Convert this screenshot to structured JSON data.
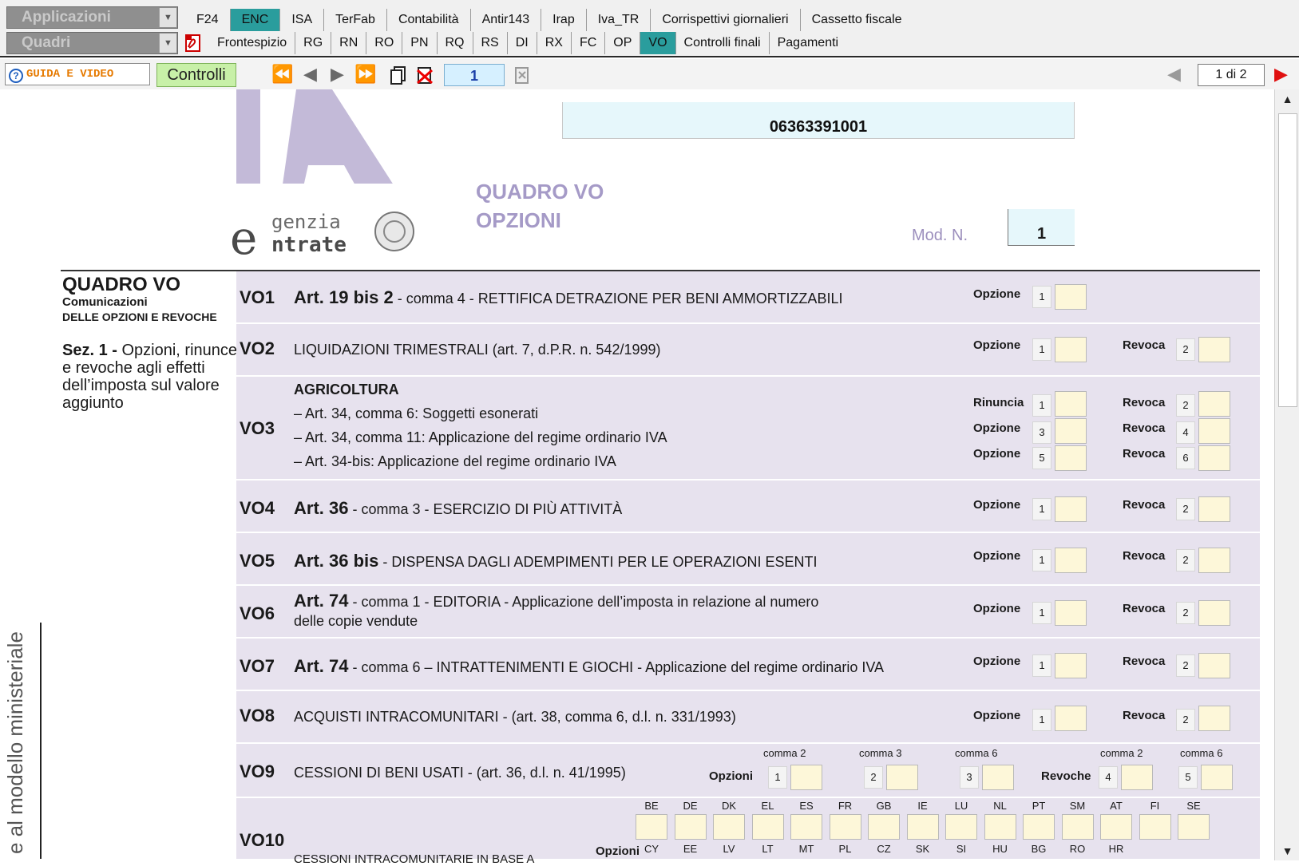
{
  "toolbar": {
    "app_combo": "Applicazioni",
    "quadri_combo": "Quadri",
    "tabs_row1": [
      "F24",
      "ENC",
      "ISA",
      "TerFab",
      "Contabilità",
      "Antir143",
      "Irap",
      "Iva_TR",
      "Corrispettivi giornalieri",
      "Cassetto fiscale"
    ],
    "tabs_row2": [
      "Frontespizio",
      "RG",
      "RN",
      "RO",
      "PN",
      "RQ",
      "RS",
      "DI",
      "RX",
      "FC",
      "OP",
      "VO",
      "Controlli finali",
      "Pagamenti"
    ],
    "selected_row1": "ENC",
    "selected_row2": "VO",
    "guida": "GUIDA E VIDEO",
    "controlli": "Controlli",
    "page_input": "1",
    "page_of": "1 di 2"
  },
  "header": {
    "codice_fiscale": "06363391001",
    "quadro_title_1": "QUADRO VO",
    "quadro_title_2": "OPZIONI",
    "mod_n_label": "Mod. N.",
    "mod_n_value": "1",
    "logo_text_1": "genzia",
    "logo_text_2": "ntrate"
  },
  "left": {
    "title": "QUADRO VO",
    "sub1": "Comunicazioni",
    "sub2": "delle opzioni e revoche",
    "sez": "Sez. 1 -",
    "sez_text": " Opzioni, rinunce e revoche agli effetti dell’imposta sul valore aggiunto",
    "side": "e al modello ministeriale"
  },
  "rows": {
    "vo1": {
      "code": "VO1",
      "art": "Art. 19 bis 2",
      "text": " - comma 4 - RETTIFICA DETRAZIONE PER BENI AMMORTIZZABILI",
      "opt_label": "Opzione",
      "opt_num": "1"
    },
    "vo2": {
      "code": "VO2",
      "text": "LIQUIDAZIONI TRIMESTRALI  (art. 7, d.P.R. n. 542/1999)",
      "opt_label": "Opzione",
      "opt_num": "1",
      "rev_label": "Revoca",
      "rev_num": "2"
    },
    "vo3": {
      "code": "VO3",
      "head": "AGRICOLTURA",
      "l1": "– Art. 34, comma   6: Soggetti esonerati",
      "l2": "– Art. 34, comma 11: Applicazione del regime ordinario IVA",
      "l3": "– Art. 34-bis: Applicazione del regime ordinario IVA",
      "a1": "Rinuncia",
      "n1": "1",
      "b1": "Revoca",
      "m1": "2",
      "a2": "Opzione",
      "n2": "3",
      "b2": "Revoca",
      "m2": "4",
      "a3": "Opzione",
      "n3": "5",
      "b3": "Revoca",
      "m3": "6"
    },
    "vo4": {
      "code": "VO4",
      "art": "Art. 36",
      "text": " - comma 3 - ESERCIZIO DI PIÙ ATTIVITÀ",
      "opt_label": "Opzione",
      "opt_num": "1",
      "rev_label": "Revoca",
      "rev_num": "2"
    },
    "vo5": {
      "code": "VO5",
      "art": "Art. 36 bis",
      "text": " - DISPENSA DAGLI ADEMPIMENTI PER LE OPERAZIONI ESENTI",
      "opt_label": "Opzione",
      "opt_num": "1",
      "rev_label": "Revoca",
      "rev_num": "2"
    },
    "vo6": {
      "code": "VO6",
      "art": "Art. 74",
      "text": " - comma 1 - EDITORIA - Applicazione dell’imposta in relazione al numero",
      "text2": "delle copie vendute",
      "opt_label": "Opzione",
      "opt_num": "1",
      "rev_label": "Revoca",
      "rev_num": "2"
    },
    "vo7": {
      "code": "VO7",
      "art": "Art. 74",
      "text": " - comma    6 – INTRATTENIMENTI E GIOCHI - Applicazione del regime ordinario IVA",
      "opt_label": "Opzione",
      "opt_num": "1",
      "rev_label": "Revoca",
      "rev_num": "2"
    },
    "vo8": {
      "code": "VO8",
      "text": "ACQUISTI INTRACOMUNITARI - (art. 38, comma 6, d.l. n. 331/1993)",
      "opt_label": "Opzione",
      "opt_num": "1",
      "rev_label": "Revoca",
      "rev_num": "2"
    },
    "vo9": {
      "code": "VO9",
      "text": "CESSIONI DI BENI USATI - (art. 36, d.l. n. 41/1995)",
      "opzioni": "Opzioni",
      "revoche": "Revoche",
      "c1": "comma 2",
      "c2": "comma 3",
      "c3": "comma 6",
      "c4": "comma 2",
      "c5": "comma 6",
      "n1": "1",
      "n2": "2",
      "n3": "3",
      "n4": "4",
      "n5": "5"
    },
    "vo10": {
      "code": "VO10",
      "text": "CESSIONI INTRACOMUNITARIE IN BASE A",
      "opzioni": "Opzioni",
      "top": [
        "BE",
        "DE",
        "DK",
        "EL",
        "ES",
        "FR",
        "GB",
        "IE",
        "LU",
        "NL",
        "PT",
        "SM",
        "AT",
        "FI",
        "SE"
      ],
      "bottom": [
        "CY",
        "EE",
        "LV",
        "LT",
        "MT",
        "PL",
        "CZ",
        "SK",
        "SI",
        "HU",
        "BG",
        "RO",
        "HR"
      ]
    }
  }
}
